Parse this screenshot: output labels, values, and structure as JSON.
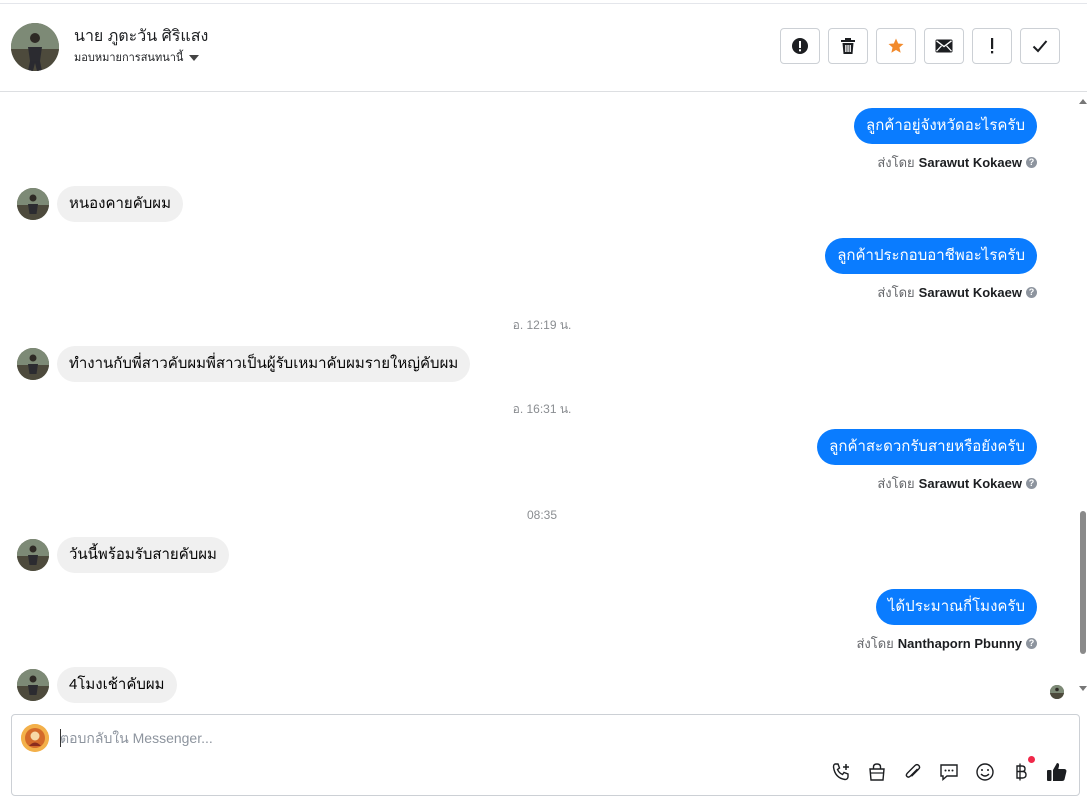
{
  "header": {
    "contact_name": "นาย ภูตะวัน ศิริแสง",
    "assign_label": "มอบหมายการสนทนานี้",
    "actions": [
      {
        "name": "report-spam-button",
        "icon": "exclamation-circle-icon"
      },
      {
        "name": "delete-button",
        "icon": "trash-icon"
      },
      {
        "name": "star-button",
        "icon": "star-icon",
        "color": "#f28a2c"
      },
      {
        "name": "mark-unread-button",
        "icon": "envelope-icon"
      },
      {
        "name": "follow-up-button",
        "icon": "exclamation-icon"
      },
      {
        "name": "mark-done-button",
        "icon": "check-icon"
      }
    ]
  },
  "conversation": {
    "messages": [
      {
        "id": "m1",
        "direction": "out",
        "text": "ลูกค้าอยู่จังหวัดอะไรครับ",
        "sent_by_label": "ส่งโดย",
        "sender": "Sarawut Kokaew"
      },
      {
        "id": "m2",
        "direction": "in",
        "text": "หนองคายคับผม"
      },
      {
        "id": "m3",
        "direction": "out",
        "text": "ลูกค้าประกอบอาชีพอะไรครับ",
        "sent_by_label": "ส่งโดย",
        "sender": "Sarawut Kokaew"
      },
      {
        "id": "t1",
        "type": "timestamp",
        "text": "อ. 12:19 น."
      },
      {
        "id": "m4",
        "direction": "in",
        "text": "ทำงานกับพี่สาวคับผมพี่สาวเป็นผู้รับเหมาคับผมรายใหญ่คับผม"
      },
      {
        "id": "t2",
        "type": "timestamp",
        "text": "อ. 16:31 น."
      },
      {
        "id": "m5",
        "direction": "out",
        "text": "ลูกค้าสะดวกรับสายหรือยังครับ",
        "sent_by_label": "ส่งโดย",
        "sender": "Sarawut Kokaew"
      },
      {
        "id": "t3",
        "type": "timestamp",
        "text": "08:35"
      },
      {
        "id": "m6",
        "direction": "in",
        "text": "วันนี้พร้อมรับสายคับผม"
      },
      {
        "id": "m7",
        "direction": "out",
        "text": "ได้ประมาณกี่โมงครับ",
        "sent_by_label": "ส่งโดย",
        "sender": "Nanthaporn Pbunny"
      },
      {
        "id": "m8",
        "direction": "in",
        "text": "4โมงเช้าคับผม"
      }
    ]
  },
  "composer": {
    "placeholder": "ตอบกลับใน Messenger...",
    "value": "",
    "tools": [
      "phone-plus-icon",
      "shopping-bag-icon",
      "paperclip-icon",
      "chat-bubble-icon",
      "emoji-icon",
      "baht-icon",
      "thumbs-up-icon"
    ]
  },
  "colors": {
    "outgoing_bubble": "#0a7cff",
    "incoming_bubble": "#f0f0f0",
    "star": "#f28a2c",
    "notification_dot": "#f02849"
  }
}
